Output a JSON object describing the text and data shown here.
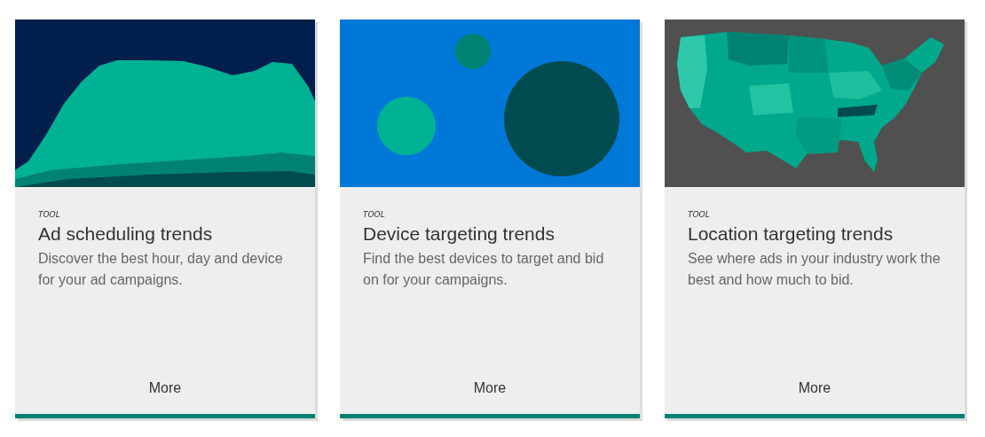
{
  "cards": [
    {
      "tag": "TOOL",
      "title": "Ad scheduling trends",
      "description": "Discover the best hour, day and device for your ad campaigns.",
      "link": "More"
    },
    {
      "tag": "TOOL",
      "title": "Device targeting trends",
      "description": "Find the best devices to target and bid on for your campaigns.",
      "link": "More"
    },
    {
      "tag": "TOOL",
      "title": "Location targeting trends",
      "description": "See where ads in your industry work the best and how much to bid.",
      "link": "More"
    }
  ]
}
